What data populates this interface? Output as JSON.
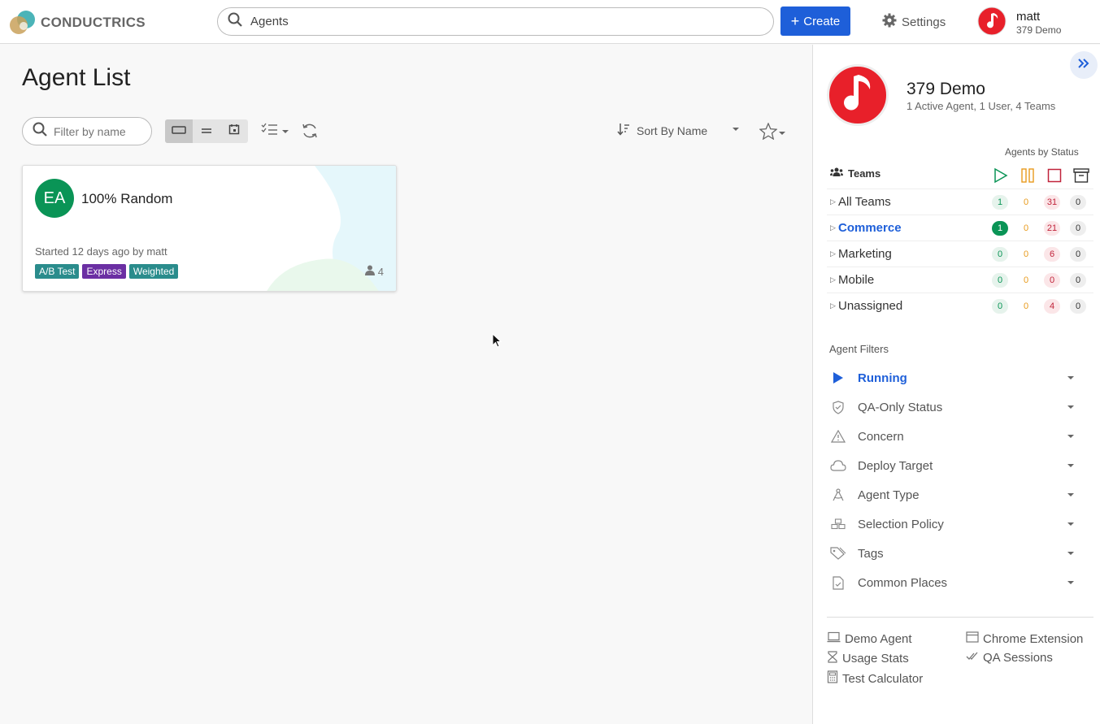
{
  "header": {
    "logo_text": "CONDUCTRICS",
    "search_value": "Agents",
    "create_label": "Create",
    "settings_label": "Settings",
    "user_name": "matt",
    "user_org": "379 Demo"
  },
  "main": {
    "title": "Agent List",
    "filter_placeholder": "Filter by name",
    "sort_label": "Sort By Name",
    "cards": [
      {
        "initials": "EA",
        "title": "100% Random",
        "meta": "Started 12 days ago by matt",
        "tags": [
          {
            "label": "A/B Test",
            "color": "#2a8c8c"
          },
          {
            "label": "Express",
            "color": "#6b2fa3"
          },
          {
            "label": "Weighted",
            "color": "#2a8c8c"
          }
        ],
        "users": "4"
      }
    ]
  },
  "side": {
    "org_name": "379 Demo",
    "org_sub": "1 Active Agent, 1 User, 4 Teams",
    "by_status": "Agents by Status",
    "teams_label": "Teams",
    "teams": [
      {
        "label": "All Teams",
        "run": "1",
        "pause": "0",
        "stop": "31",
        "arch": "0"
      },
      {
        "label": "Commerce",
        "run": "1",
        "pause": "0",
        "stop": "21",
        "arch": "0"
      },
      {
        "label": "Marketing",
        "run": "0",
        "pause": "0",
        "stop": "6",
        "arch": "0"
      },
      {
        "label": "Mobile",
        "run": "0",
        "pause": "0",
        "stop": "0",
        "arch": "0"
      },
      {
        "label": "Unassigned",
        "run": "0",
        "pause": "0",
        "stop": "4",
        "arch": "0"
      }
    ],
    "filters_title": "Agent Filters",
    "filters": [
      {
        "label": "Running",
        "icon": "play-icon"
      },
      {
        "label": "QA-Only Status",
        "icon": "shield-check-icon"
      },
      {
        "label": "Concern",
        "icon": "warning-icon"
      },
      {
        "label": "Deploy Target",
        "icon": "cloud-icon"
      },
      {
        "label": "Agent Type",
        "icon": "compass-icon"
      },
      {
        "label": "Selection Policy",
        "icon": "boxes-icon"
      },
      {
        "label": "Tags",
        "icon": "tags-icon"
      },
      {
        "label": "Common Places",
        "icon": "file-check-icon"
      }
    ],
    "links": {
      "demo_agent": "Demo Agent",
      "chrome_extension": "Chrome Extension",
      "usage_stats": "Usage Stats",
      "qa_sessions": "QA Sessions",
      "test_calculator": "Test Calculator"
    }
  },
  "colors": {
    "primary": "#1e5fd9",
    "running": "#0a9456",
    "paused": "#e89a1c",
    "stopped": "#c0233a",
    "org_logo": "#e8202a"
  }
}
